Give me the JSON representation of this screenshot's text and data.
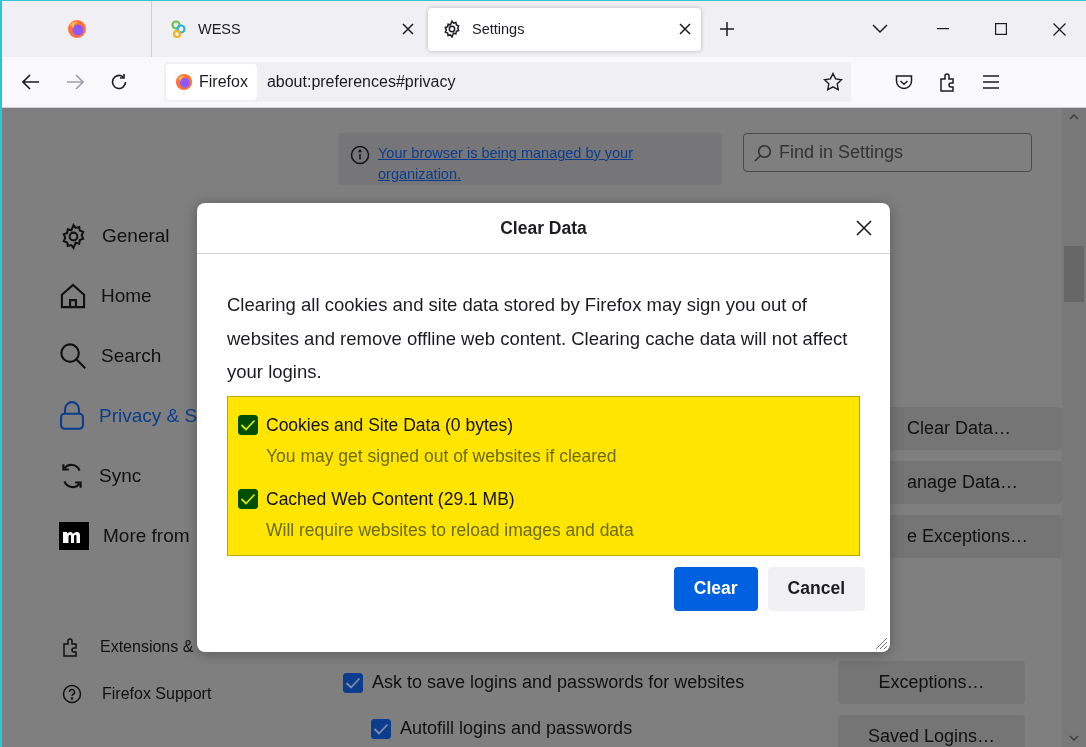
{
  "tabs": [
    {
      "kind": "pinned",
      "selected": false
    },
    {
      "kind": "site",
      "title": "WESS",
      "selected": false
    },
    {
      "kind": "settings",
      "title": "Settings",
      "selected": true
    }
  ],
  "address_bar": {
    "identity": "Firefox",
    "url": "about:preferences#privacy"
  },
  "notice": {
    "link": "Your browser is being managed by your organization."
  },
  "search": {
    "placeholder": "Find in Settings"
  },
  "sidebar": {
    "items": [
      {
        "label": "General",
        "selected": false
      },
      {
        "label": "Home",
        "selected": false
      },
      {
        "label": "Search",
        "selected": false
      },
      {
        "label": "Privacy & S",
        "selected": true
      },
      {
        "label": "Sync",
        "selected": false
      },
      {
        "label": "More from",
        "selected": false
      }
    ],
    "footer": [
      {
        "label": "Extensions &"
      },
      {
        "label": "Firefox Support"
      }
    ]
  },
  "data_buttons": [
    "Clear Data…",
    "anage Data…",
    "e Exceptions…"
  ],
  "logins": {
    "options": [
      {
        "label": "Ask to save logins and passwords for websites",
        "checked": true,
        "children": [
          {
            "label": "Autofill logins and passwords",
            "checked": true
          }
        ]
      }
    ],
    "buttons": [
      "Exceptions…",
      "Saved Logins…"
    ]
  },
  "dialog": {
    "title": "Clear Data",
    "message": "Clearing all cookies and site data stored by Firefox may sign you out of websites and remove offline web content. Clearing cache data will not affect your logins.",
    "options": [
      {
        "label": "Cookies and Site Data (0 bytes)",
        "description": "You may get signed out of websites if cleared",
        "checked": true
      },
      {
        "label": "Cached Web Content (29.1 MB)",
        "description": "Will require websites to reload images and data",
        "checked": true
      }
    ],
    "buttons": [
      {
        "label": "Clear",
        "kind": "primary"
      },
      {
        "label": "Cancel",
        "kind": "secondary"
      }
    ]
  }
}
